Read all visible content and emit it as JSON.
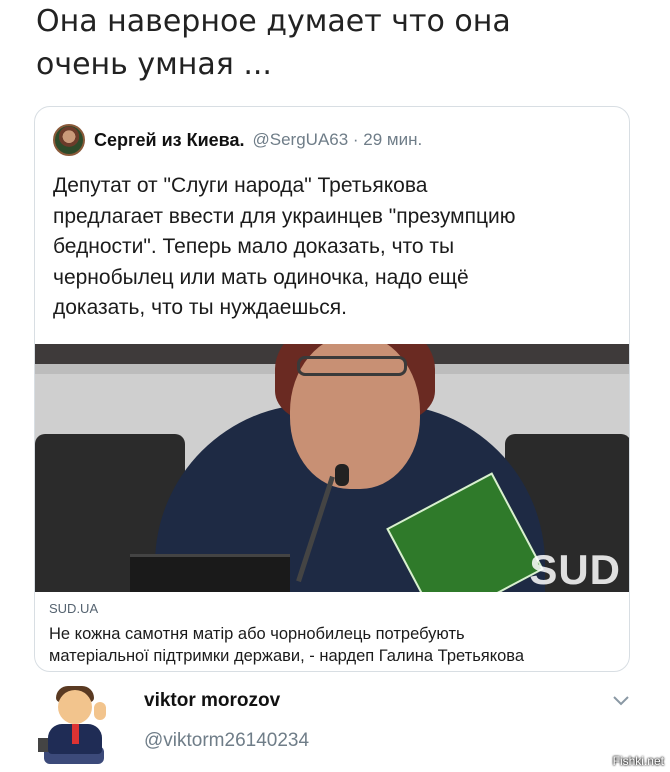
{
  "caption": "Она наверное думает что она\nочень умная ...",
  "tweet": {
    "author_name": "Сергей из Киева.",
    "author_meta": "@SergUA63 · 29 мин.",
    "text": "Депутат от \"Слуги народа\" Третьякова\nпредлагает ввести для украинцев \"презумпцию\nбедности\". Теперь мало доказать, что ты\nчернобылец или мать одиночка, надо ещё\nдоказать, что ты нуждаешься.",
    "photo_watermark": "SUD",
    "link_source": "SUD.UA",
    "link_title": "Не кожна самотня матір або чорнобилець потребують\nматеріальної підтримки держави, - нардеп Галина Третьякова"
  },
  "reply": {
    "name": "viktor morozov",
    "handle": "@viktorm26140234",
    "chevron_icon": "chevron-down-icon"
  },
  "site_watermark": "Fishki.net"
}
